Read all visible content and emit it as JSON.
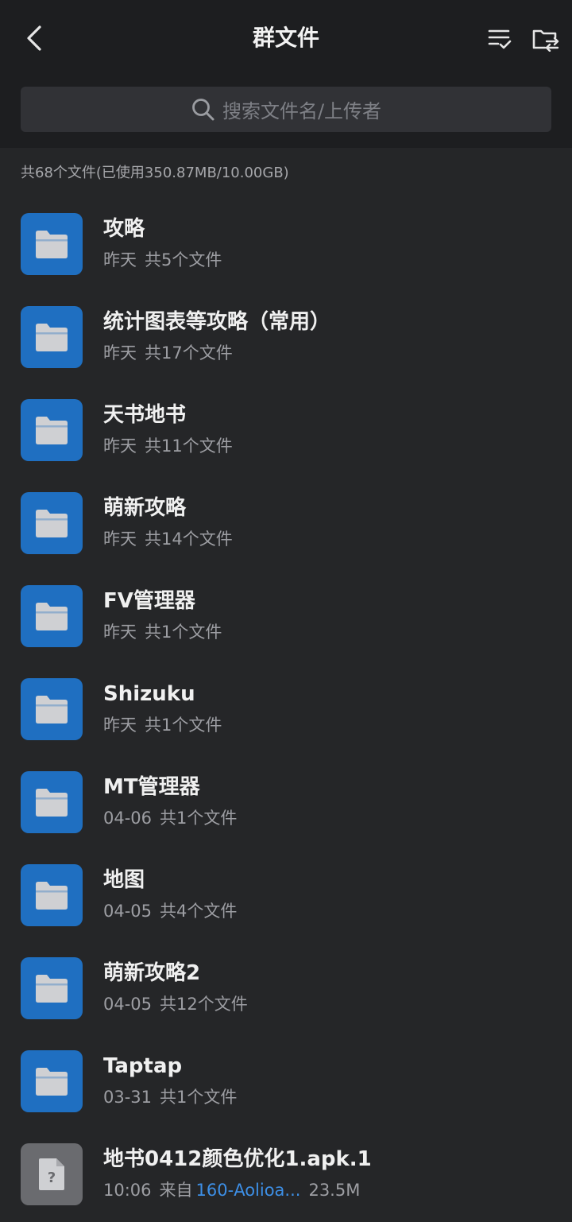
{
  "header": {
    "title": "群文件",
    "back_icon": "chevron-left-icon",
    "sort_icon": "sort-list-icon",
    "folder_icon": "folder-switch-icon"
  },
  "search": {
    "placeholder": "搜索文件名/上传者"
  },
  "summary": "共68个文件(已使用350.87MB/10.00GB)",
  "colors": {
    "folder_icon_bg": "#1f6fc1",
    "file_icon_bg": "#6a6b6f",
    "uploader_link": "#3d8fe6",
    "background": "#252628"
  },
  "items": [
    {
      "name": "攻略",
      "date": "昨天",
      "count": "共5个文件"
    },
    {
      "name": "统计图表等攻略（常用）",
      "date": "昨天",
      "count": "共17个文件"
    },
    {
      "name": "天书地书",
      "date": "昨天",
      "count": "共11个文件"
    },
    {
      "name": "萌新攻略",
      "date": "昨天",
      "count": "共14个文件"
    },
    {
      "name": "FV管理器",
      "date": "昨天",
      "count": "共1个文件"
    },
    {
      "name": "Shizuku",
      "date": "昨天",
      "count": "共1个文件"
    },
    {
      "name": "MT管理器",
      "date": "04-06",
      "count": "共1个文件"
    },
    {
      "name": "地图",
      "date": "04-05",
      "count": "共4个文件"
    },
    {
      "name": "萌新攻略2",
      "date": "04-05",
      "count": "共12个文件"
    },
    {
      "name": "Taptap",
      "date": "03-31",
      "count": "共1个文件"
    }
  ],
  "file": {
    "name": "地书0412颜色优化1.apk.1",
    "time": "10:06",
    "from_label": "来自",
    "uploader": "160-Aolioa...",
    "size": "23.5M"
  }
}
